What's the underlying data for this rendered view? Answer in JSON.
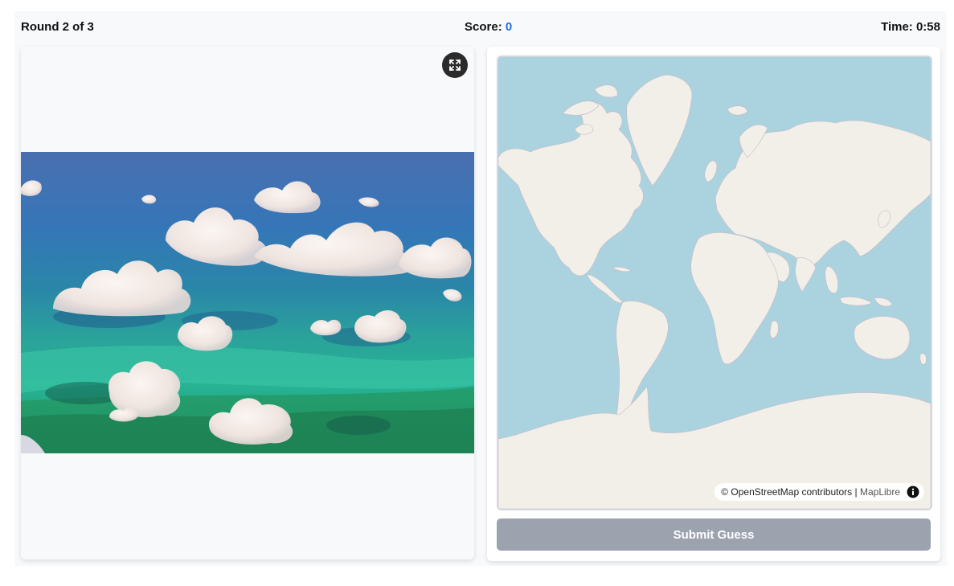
{
  "header": {
    "round_text": "Round 2 of 3",
    "score_label": "Score:",
    "score_value": "0",
    "time_label": "Time:",
    "time_value": "0:58"
  },
  "photo_panel": {
    "expand_icon": "expand-icon"
  },
  "map": {
    "attribution_osm": "© OpenStreetMap contributors",
    "attribution_sep": "|",
    "attribution_maplibre": "MapLibre",
    "info_icon": "info-icon",
    "ocean_color": "#aad3df",
    "land_color": "#f2efe9"
  },
  "actions": {
    "submit_label": "Submit Guess",
    "submit_color": "#9ca3af"
  },
  "colors": {
    "score_accent": "#1f6fe0"
  }
}
